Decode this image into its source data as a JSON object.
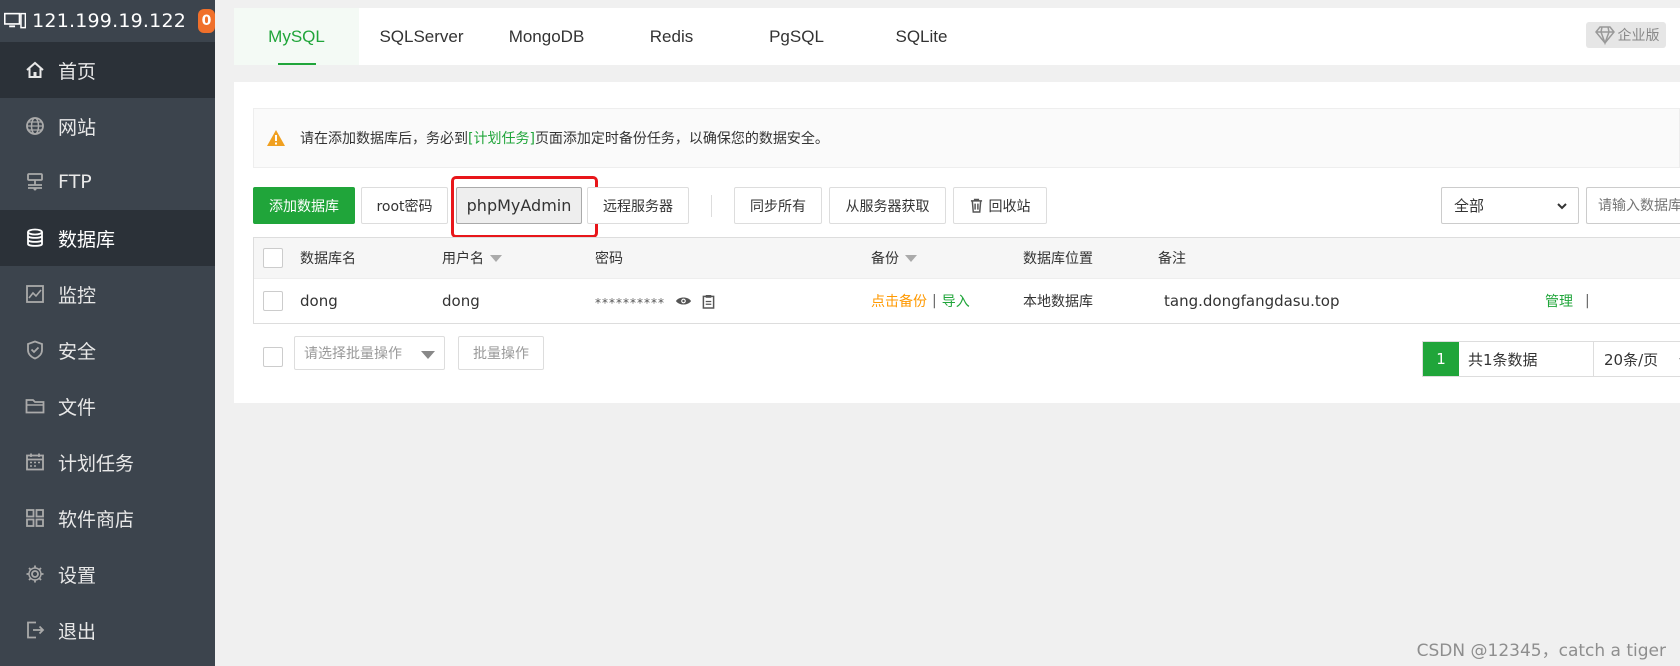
{
  "sidebar": {
    "ip": "121.199.19.122",
    "badge": "0",
    "items": [
      {
        "label": "首页",
        "icon": "home-icon"
      },
      {
        "label": "网站",
        "icon": "globe-icon"
      },
      {
        "label": "FTP",
        "icon": "ftp-icon"
      },
      {
        "label": "数据库",
        "icon": "database-icon"
      },
      {
        "label": "监控",
        "icon": "monitor-icon"
      },
      {
        "label": "安全",
        "icon": "shield-icon"
      },
      {
        "label": "文件",
        "icon": "folder-icon"
      },
      {
        "label": "计划任务",
        "icon": "calendar-icon"
      },
      {
        "label": "软件商店",
        "icon": "apps-icon"
      },
      {
        "label": "设置",
        "icon": "gear-icon"
      },
      {
        "label": "退出",
        "icon": "logout-icon"
      }
    ]
  },
  "tabs": [
    "MySQL",
    "SQLServer",
    "MongoDB",
    "Redis",
    "PgSQL",
    "SQLite"
  ],
  "enterprise_label": "企业版",
  "alert": {
    "pre": "请在添加数据库后，务必到",
    "link": "[计划任务]",
    "post": "页面添加定时备份任务，以确保您的数据安全。"
  },
  "toolbar": {
    "add": "添加数据库",
    "root_pw": "root密码",
    "pma": "phpMyAdmin",
    "remote": "远程服务器",
    "sync_all": "同步所有",
    "fetch": "从服务器获取",
    "recycle": "回收站",
    "filter_value": "全部",
    "search_placeholder": "请输入数据库"
  },
  "table": {
    "headers": {
      "name": "数据库名",
      "user": "用户名",
      "password": "密码",
      "backup": "备份",
      "location": "数据库位置",
      "remark": "备注"
    },
    "rows": [
      {
        "name": "dong",
        "user": "dong",
        "password": "**********",
        "backup": "点击备份",
        "import": "导入",
        "location": "本地数据库",
        "remark": "tang.dongfangdasu.top",
        "manage": "管理"
      }
    ]
  },
  "batch": {
    "placeholder": "请选择批量操作",
    "button": "批量操作"
  },
  "pager": {
    "current": "1",
    "total": "共1条数据",
    "per_page": "20条/页"
  },
  "watermark": "CSDN @12345，catch a tiger",
  "colors": {
    "accent": "#20a53a",
    "sidebar": "#3c444d",
    "highlight": "#e8161a",
    "badge": "#f0702b",
    "backup_link": "#ff9900"
  }
}
